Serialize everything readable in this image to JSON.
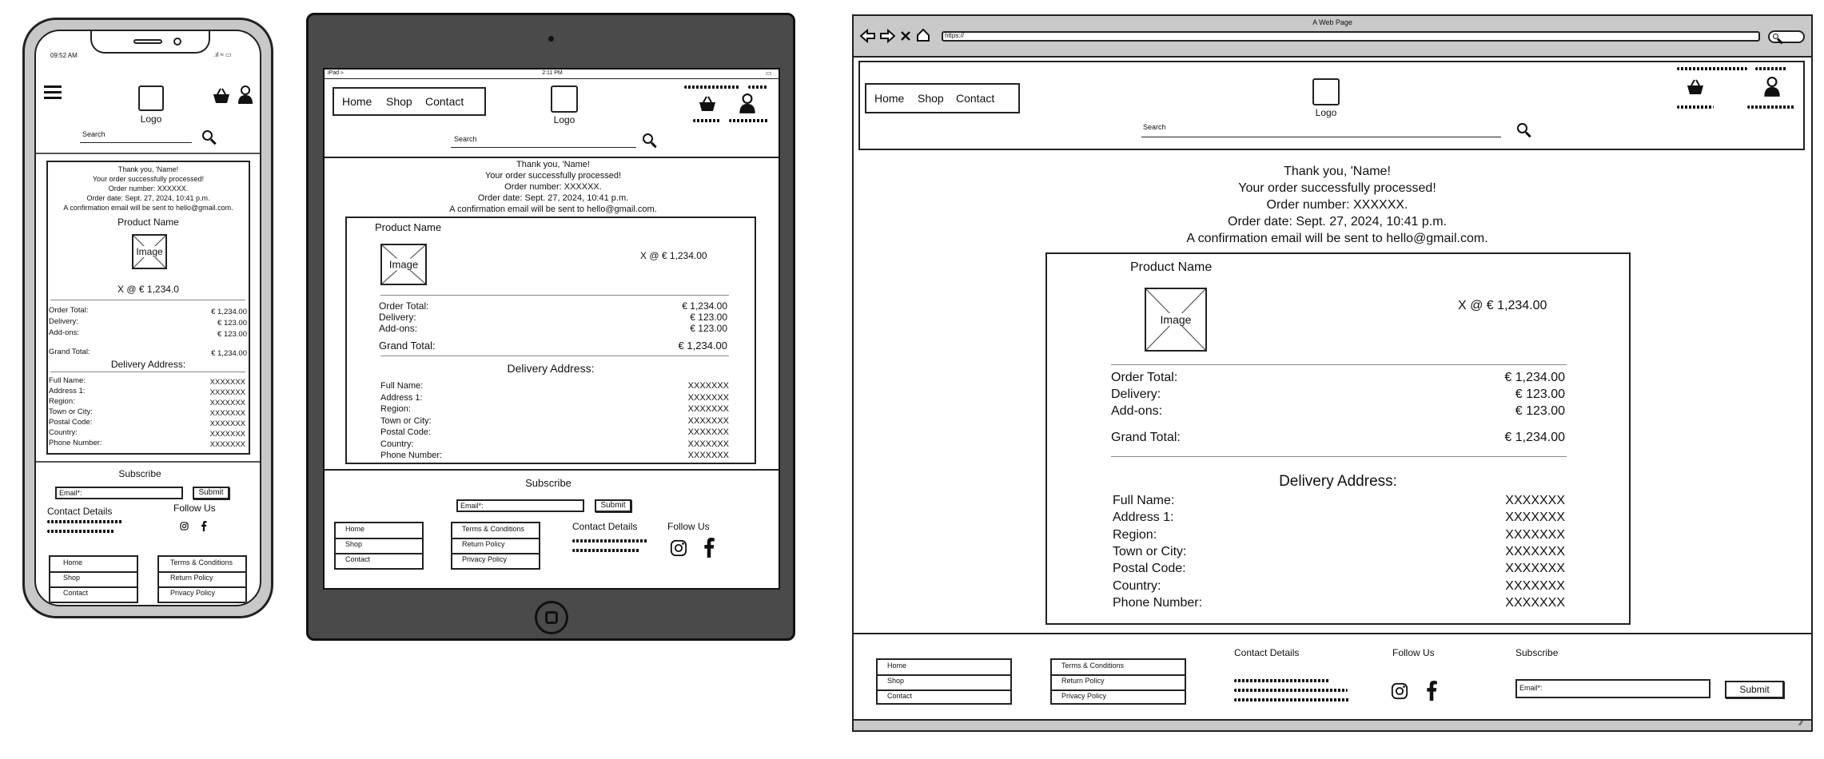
{
  "phone": {
    "status_time": "09:52 AM",
    "logo": "Logo",
    "search_placeholder": "Search",
    "confirm": {
      "thanks": "Thank you, 'Name!",
      "processed": "Your order successfully processed!",
      "order_number": "Order number: XXXXXX.",
      "order_date": "Order date: Sept. 27, 2024, 10:41 p.m.",
      "email_note": "A confirmation email will be sent to hello@gmail.com."
    },
    "product_name": "Product Name",
    "image_label": "Image",
    "qty_price": "X @ € 1,234.0",
    "totals": {
      "order_total_label": "Order Total:",
      "order_total": "€ 1,234.00",
      "delivery_label": "Delivery:",
      "delivery": "€ 123.00",
      "addons_label": "Add-ons:",
      "addons": "€ 123.00",
      "grand_total_label": "Grand Total:",
      "grand_total": "€ 1,234.00"
    },
    "delivery_title": "Delivery Address:",
    "address": [
      {
        "label": "Full Name:",
        "value": "XXXXXXX"
      },
      {
        "label": "Address 1:",
        "value": "XXXXXXX"
      },
      {
        "label": "Region:",
        "value": "XXXXXXX"
      },
      {
        "label": "Town or City:",
        "value": "XXXXXXX"
      },
      {
        "label": "Postal Code:",
        "value": "XXXXXXX"
      },
      {
        "label": "Country:",
        "value": "XXXXXXX"
      },
      {
        "label": "Phone Number:",
        "value": "XXXXXXX"
      }
    ],
    "subscribe": "Subscribe",
    "email_placeholder": "Email*:",
    "submit": "Submit",
    "contact_details": "Contact Details",
    "follow_us": "Follow Us",
    "footer_links_left": [
      "Home",
      "Shop",
      "Contact"
    ],
    "footer_links_right": [
      "Terms & Conditions",
      "Return Policy",
      "Privacy Policy"
    ]
  },
  "tablet": {
    "status_left": "iPad",
    "status_time": "2:11 PM",
    "nav": [
      "Home",
      "Shop",
      "Contact"
    ],
    "logo": "Logo",
    "search_placeholder": "Search",
    "confirm": {
      "thanks": "Thank you, 'Name!",
      "processed": "Your order successfully processed!",
      "order_number": "Order number: XXXXXX.",
      "order_date": "Order date: Sept. 27, 2024, 10:41 p.m.",
      "email_note": "A confirmation email will be sent to hello@gmail.com."
    },
    "product_name": "Product Name",
    "image_label": "Image",
    "qty_price": "X @ € 1,234.00",
    "totals": {
      "order_total_label": "Order Total:",
      "order_total": "€ 1,234.00",
      "delivery_label": "Delivery:",
      "delivery": "€ 123.00",
      "addons_label": "Add-ons:",
      "addons": "€ 123.00",
      "grand_total_label": "Grand Total:",
      "grand_total": "€ 1,234.00"
    },
    "delivery_title": "Delivery Address:",
    "address": [
      {
        "label": "Full Name:",
        "value": "XXXXXXX"
      },
      {
        "label": "Address 1:",
        "value": "XXXXXXX"
      },
      {
        "label": "Region:",
        "value": "XXXXXXX"
      },
      {
        "label": "Town or City:",
        "value": "XXXXXXX"
      },
      {
        "label": "Postal Code:",
        "value": "XXXXXXX"
      },
      {
        "label": "Country:",
        "value": "XXXXXXX"
      },
      {
        "label": "Phone Number:",
        "value": "XXXXXXX"
      }
    ],
    "subscribe": "Subscribe",
    "email_placeholder": "Email*:",
    "submit": "Submit",
    "contact_details": "Contact Details",
    "follow_us": "Follow Us",
    "footer_links_left": [
      "Home",
      "Shop",
      "Contact"
    ],
    "footer_links_right": [
      "Terms & Conditions",
      "Return Policy",
      "Privacy Policy"
    ]
  },
  "desktop": {
    "window_title": "A Web Page",
    "url": "https://",
    "nav": [
      "Home",
      "Shop",
      "Contact"
    ],
    "logo": "Logo",
    "search_placeholder": "Search",
    "confirm": {
      "thanks": "Thank you, 'Name!",
      "processed": "Your order successfully processed!",
      "order_number": "Order number: XXXXXX.",
      "order_date": "Order date: Sept. 27, 2024, 10:41 p.m.",
      "email_note": "A confirmation email will be sent to hello@gmail.com."
    },
    "product_name": "Product Name",
    "image_label": "Image",
    "qty_price": "X @ € 1,234.00",
    "totals": {
      "order_total_label": "Order Total:",
      "order_total": "€ 1,234.00",
      "delivery_label": "Delivery:",
      "delivery": "€ 123.00",
      "addons_label": "Add-ons:",
      "addons": "€ 123.00",
      "grand_total_label": "Grand Total:",
      "grand_total": "€ 1,234.00"
    },
    "delivery_title": "Delivery Address:",
    "address": [
      {
        "label": "Full Name:",
        "value": "XXXXXXX"
      },
      {
        "label": "Address 1:",
        "value": "XXXXXXX"
      },
      {
        "label": "Region:",
        "value": "XXXXXXX"
      },
      {
        "label": "Town or City:",
        "value": "XXXXXXX"
      },
      {
        "label": "Postal Code:",
        "value": "XXXXXXX"
      },
      {
        "label": "Country:",
        "value": "XXXXXXX"
      },
      {
        "label": "Phone Number:",
        "value": "XXXXXXX"
      }
    ],
    "contact_details": "Contact Details",
    "follow_us": "Follow Us",
    "subscribe": "Subscribe",
    "email_placeholder": "Email*:",
    "submit": "Submit",
    "footer_links_left": [
      "Home",
      "Shop",
      "Contact"
    ],
    "footer_links_right": [
      "Terms & Conditions",
      "Return Policy",
      "Privacy Policy"
    ]
  },
  "icons": [
    "menu-icon",
    "basket-icon",
    "user-icon",
    "search-icon",
    "instagram-icon",
    "facebook-icon",
    "back-icon",
    "forward-icon",
    "close-icon",
    "home-icon"
  ],
  "colors": {
    "frame_dark": "#4a4a4a",
    "phone_frame": "#c8c8c8",
    "browser_chrome": "#c9c9c9",
    "ink": "#222222"
  }
}
